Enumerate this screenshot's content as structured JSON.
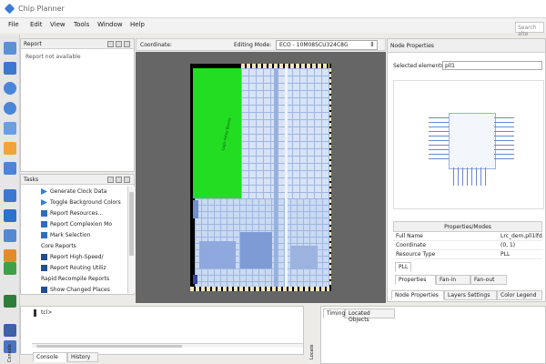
{
  "app": {
    "title": "Chip Planner"
  },
  "menu": [
    "File",
    "Edit",
    "View",
    "Tools",
    "Window",
    "Help"
  ],
  "search": {
    "placeholder": "Search alte"
  },
  "report_panel": {
    "title": "Report",
    "placeholder": "Report not available"
  },
  "tasks_panel": {
    "title": "Tasks",
    "items": [
      {
        "label": "Generate Clock Data",
        "icon": "play-icon"
      },
      {
        "label": "Toggle Background Colors",
        "icon": "play-icon"
      },
      {
        "label": "Report Resources...",
        "icon": "report-icon"
      },
      {
        "label": "Report Complexion Mo",
        "icon": "report-icon"
      },
      {
        "label": "Mark Selection",
        "icon": "report-icon"
      },
      {
        "label": "Core Reports",
        "icon": "folder-icon"
      },
      {
        "label": "Report High-Speed/",
        "icon": "table-icon"
      },
      {
        "label": "Report Routing Utiliz",
        "icon": "table-icon"
      },
      {
        "label": "Rapid Recompile Reports",
        "icon": "folder-icon"
      },
      {
        "label": "Show Changed Places",
        "icon": "table-icon"
      }
    ]
  },
  "center_header": {
    "coordinate_label": "Coordinate:",
    "editing_mode_label": "Editing Mode:",
    "editing_mode_value": "ECO - 10M08SCU324C8G"
  },
  "chip_label": "Logic Array Blocks",
  "node_properties": {
    "title": "Node Properties",
    "selected_label": "Selected elements:",
    "selected_value": "pll1",
    "section_header": "Properties/Modes",
    "rows": [
      {
        "key": "Full Name",
        "value": "Lrc_dem,pll1lfd"
      },
      {
        "key": "Coordinate",
        "value": "(0, 1)"
      },
      {
        "key": "Resource Type",
        "value": "PLL"
      }
    ],
    "small_tab": "PLL",
    "tabs": [
      "Properties",
      "Fan-in",
      "Fan-out"
    ],
    "bottom_tabs": [
      "Node Properties",
      "Layers Settings",
      "Color Legend"
    ]
  },
  "console": {
    "tabs": [
      "Console",
      "History"
    ],
    "prompt": "tcl>",
    "side_label": "Console"
  },
  "lower_right": {
    "tabs": [
      "Timing",
      "Located Objects"
    ],
    "side_label": "Locate"
  },
  "colors": {
    "green_region": "#22dd22",
    "grid": "#d7e3f6",
    "grid_line": "#9fb6e0",
    "canvas_bg": "#666666"
  }
}
